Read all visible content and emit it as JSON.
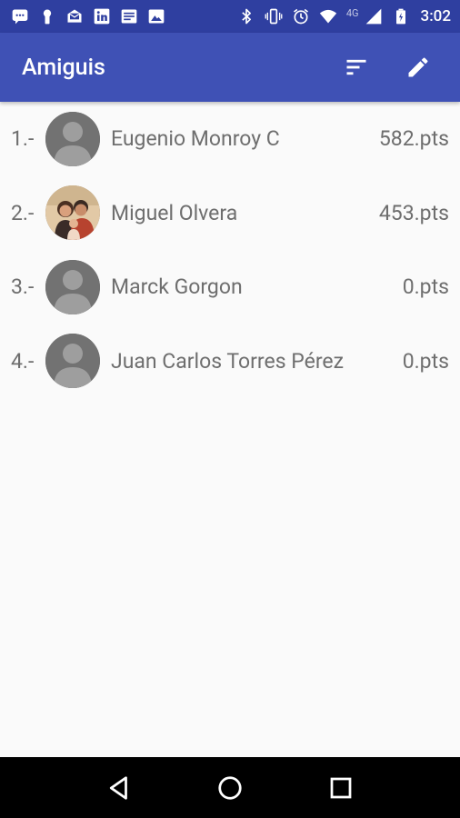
{
  "status_bar": {
    "network": "4G",
    "time": "3:02",
    "left_icons": [
      "message-icon",
      "keyhole-icon",
      "mail-icon",
      "linkedin-icon",
      "news-icon",
      "image-icon"
    ],
    "right_icons": [
      "bluetooth-icon",
      "vibrate-icon",
      "alarm-icon",
      "wifi-icon",
      "signal-icon",
      "battery-icon"
    ]
  },
  "app_bar": {
    "title": "Amiguis",
    "actions": [
      {
        "name": "sort",
        "icon": "sort-icon"
      },
      {
        "name": "edit",
        "icon": "pencil-icon"
      }
    ],
    "color": "#3f51b5"
  },
  "friends": [
    {
      "rank": "1.-",
      "name": "Eugenio Monroy C",
      "points": "582.pts",
      "avatar": "default-avatar"
    },
    {
      "rank": "2.-",
      "name": "Miguel Olvera",
      "points": "453.pts",
      "avatar": "photo-avatar"
    },
    {
      "rank": "3.-",
      "name": "Marck Gorgon",
      "points": "0.pts",
      "avatar": "default-avatar"
    },
    {
      "rank": "4.-",
      "name": "Juan Carlos Torres Pérez",
      "points": "0.pts",
      "avatar": "default-avatar"
    }
  ],
  "nav_bar": {
    "buttons": [
      "back-icon",
      "home-icon",
      "recents-icon"
    ]
  }
}
